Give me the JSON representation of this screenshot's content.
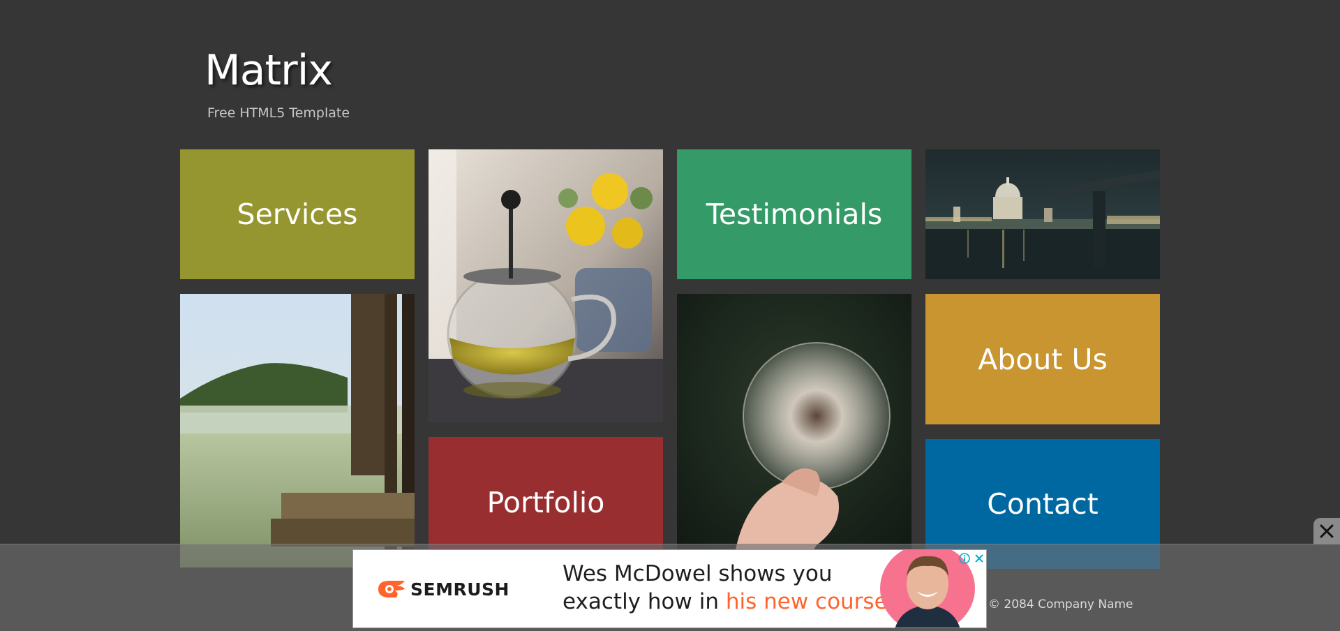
{
  "header": {
    "title": "Matrix",
    "subtitle": "Free HTML5 Template"
  },
  "tiles": {
    "services": {
      "label": "Services",
      "color": "#969630"
    },
    "testimonials": {
      "label": "Testimonials",
      "color": "#349b68"
    },
    "about": {
      "label": "About Us",
      "color": "#c99530"
    },
    "portfolio": {
      "label": "Portfolio",
      "color": "#982e30"
    },
    "contact": {
      "label": "Contact",
      "color": "#0068a0"
    }
  },
  "images": {
    "city": "city-night-photo",
    "teapot": "teapot-with-flowers-photo",
    "lake": "lake-dock-photo",
    "dandelion": "dandelion-in-hand-photo"
  },
  "footer": {
    "copyright": "© 2084 Company Name"
  },
  "ad": {
    "brand": "SEMRUSH",
    "line1": "Wes McDowel shows you",
    "line2_prefix": "exactly how in ",
    "line2_accent": "his new course",
    "accent_color": "#ff642d"
  }
}
